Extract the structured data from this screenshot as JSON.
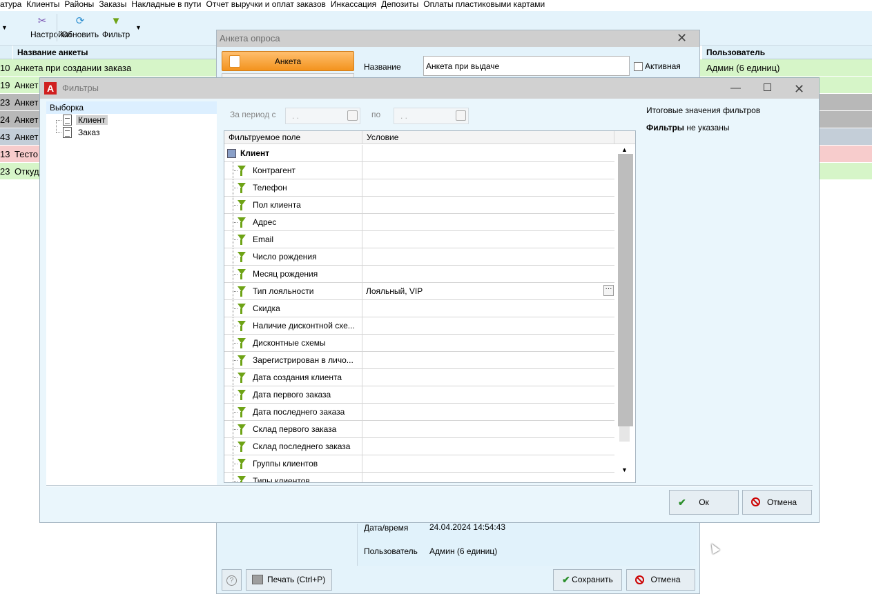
{
  "menu": [
    "атура",
    "Клиенты",
    "Районы",
    "Заказы",
    "Накладные в пути",
    "Отчет выручки и оплат заказов",
    "Инкассация",
    "Депозиты",
    "Оплаты пластиковыми картами"
  ],
  "toolbar": {
    "settings": "Настройки",
    "refresh": "Обновить",
    "filter": "Фильтр"
  },
  "grid": {
    "col_name": "Название анкеты",
    "col_user": "Пользователь",
    "rows": [
      {
        "id": "10",
        "name": "Анкета при создании заказа",
        "user": "Админ (6 единиц)",
        "color": "#d6f5c8"
      },
      {
        "id": "19",
        "name": "Анкет",
        "user": "",
        "color": "#d6f5c8"
      },
      {
        "id": "23",
        "name": "Анкет",
        "user": "",
        "color": "#b8b8b8"
      },
      {
        "id": "24",
        "name": "Анкет",
        "user": "",
        "color": "#b8b8b8"
      },
      {
        "id": "43",
        "name": "Анкет",
        "user": "",
        "color": "#c4ced8"
      },
      {
        "id": "13",
        "name": "Тесто",
        "user": "",
        "color": "#f7cccc"
      },
      {
        "id": "23",
        "name": "Откуд",
        "user": "",
        "color": "#d6f5c8"
      }
    ]
  },
  "anketa": {
    "title": "Анкета опроса",
    "tab_label": "Анкета",
    "name_label": "Название",
    "name_value": "Анкета при выдаче",
    "active_label": "Активная",
    "date_label": "Дата/время",
    "date_value": "24.04.2024 14:54:43",
    "user_label": "Пользователь",
    "user_value": "Админ (6 единиц)",
    "print": "Печать (Ctrl+P)",
    "save": "Сохранить",
    "cancel": "Отмена"
  },
  "filters": {
    "title": "Фильтры",
    "tree_header": "Выборка",
    "tree": [
      "Клиент",
      "Заказ"
    ],
    "period_label": "За период с",
    "period_to": "по",
    "date_placeholder": ". .",
    "col_field": "Фильтруемое поле",
    "col_condition": "Условие",
    "group": "Клиент",
    "rows": [
      {
        "field": "Контрагент",
        "cond": ""
      },
      {
        "field": "Телефон",
        "cond": ""
      },
      {
        "field": "Пол клиента",
        "cond": ""
      },
      {
        "field": "Адрес",
        "cond": ""
      },
      {
        "field": "Email",
        "cond": ""
      },
      {
        "field": "Число рождения",
        "cond": ""
      },
      {
        "field": "Месяц рождения",
        "cond": ""
      },
      {
        "field": "Тип лояльности",
        "cond": "Лояльный, VIP"
      },
      {
        "field": "Скидка",
        "cond": ""
      },
      {
        "field": "Наличие дисконтной схе...",
        "cond": ""
      },
      {
        "field": "Дисконтные схемы",
        "cond": ""
      },
      {
        "field": "Зарегистрирован в личо...",
        "cond": ""
      },
      {
        "field": "Дата создания клиента",
        "cond": ""
      },
      {
        "field": "Дата первого заказа",
        "cond": ""
      },
      {
        "field": "Дата последнего заказа",
        "cond": ""
      },
      {
        "field": "Склад первого заказа",
        "cond": ""
      },
      {
        "field": "Склад последнего заказа",
        "cond": ""
      },
      {
        "field": "Группы клиентов",
        "cond": ""
      },
      {
        "field": "Типы клиентов",
        "cond": ""
      }
    ],
    "summary_title": "Итоговые значения фильтров",
    "summary_bold": "Фильтры",
    "summary_rest": " не указаны",
    "ok": "Ок",
    "cancel": "Отмена"
  }
}
